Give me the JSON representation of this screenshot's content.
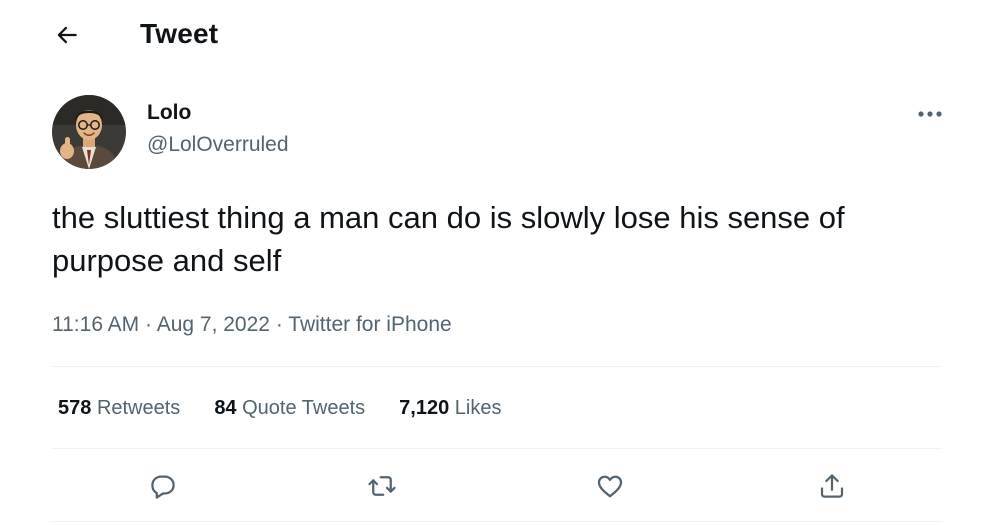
{
  "header": {
    "back_icon": "arrow-left-icon",
    "title": "Tweet"
  },
  "tweet": {
    "author": {
      "name": "Lolo",
      "handle": "@LolOverruled",
      "avatar_icon": "cartoon-avatar"
    },
    "more_icon": "more-horizontal-icon",
    "text": "the sluttiest thing a man can do is slowly lose his sense of purpose and self",
    "meta": {
      "time": "11:16 AM",
      "separator": "·",
      "date": "Aug 7, 2022",
      "source": "Twitter for iPhone"
    },
    "stats": {
      "retweets": {
        "count": "578",
        "label": "Retweets"
      },
      "quotes": {
        "count": "84",
        "label": "Quote Tweets"
      },
      "likes": {
        "count": "7,120",
        "label": "Likes"
      }
    },
    "actions": {
      "reply_icon": "reply-icon",
      "retweet_icon": "retweet-icon",
      "like_icon": "heart-icon",
      "share_icon": "share-icon"
    }
  },
  "colors": {
    "text_primary": "#0f1419",
    "text_secondary": "#536471",
    "divider": "#eff3f4"
  }
}
